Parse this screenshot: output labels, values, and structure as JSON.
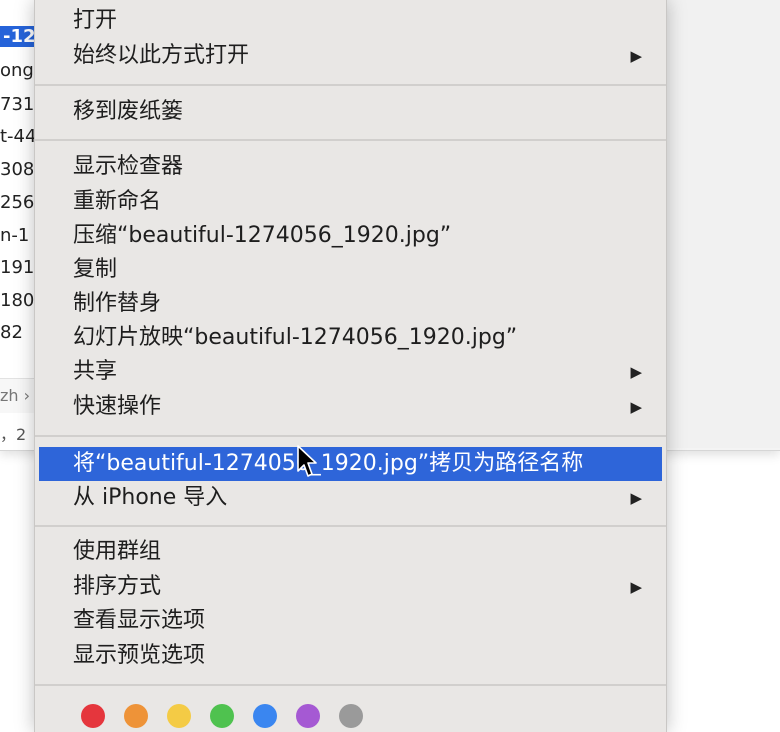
{
  "background": {
    "file_list": [
      "-12",
      "ong",
      "731",
      "t-44",
      "308",
      "256",
      "n-1",
      "191",
      "180",
      "82"
    ],
    "path_bar": "zh ›",
    "status_bar": "，2"
  },
  "menu": {
    "groups": [
      [
        {
          "label": "打开",
          "submenu": false
        },
        {
          "label": "始终以此方式打开",
          "submenu": true
        }
      ],
      [
        {
          "label": "移到废纸篓",
          "submenu": false
        }
      ],
      [
        {
          "label": "显示检查器",
          "submenu": false
        },
        {
          "label": "重新命名",
          "submenu": false
        },
        {
          "label": "压缩“beautiful-1274056_1920.jpg”",
          "submenu": false
        },
        {
          "label": "复制",
          "submenu": false
        },
        {
          "label": "制作替身",
          "submenu": false
        },
        {
          "label": "幻灯片放映“beautiful-1274056_1920.jpg”",
          "submenu": false
        },
        {
          "label": "共享",
          "submenu": true
        },
        {
          "label": "快速操作",
          "submenu": true
        }
      ],
      [
        {
          "label": "将“beautiful-1274056_1920.jpg”拷贝为路径名称",
          "submenu": false,
          "highlighted": true
        },
        {
          "label": "从 iPhone 导入",
          "submenu": true
        }
      ],
      [
        {
          "label": "使用群组",
          "submenu": false
        },
        {
          "label": "排序方式",
          "submenu": true
        },
        {
          "label": "查看显示选项",
          "submenu": false
        },
        {
          "label": "显示预览选项",
          "submenu": false
        }
      ]
    ],
    "submenu_arrow": "▶",
    "tag_colors": [
      {
        "name": "red",
        "color": "#e5363d"
      },
      {
        "name": "orange",
        "color": "#ee9338"
      },
      {
        "name": "yellow",
        "color": "#f4cb45"
      },
      {
        "name": "green",
        "color": "#4fc24f"
      },
      {
        "name": "blue",
        "color": "#3a86f0"
      },
      {
        "name": "purple",
        "color": "#a559d3"
      },
      {
        "name": "gray",
        "color": "#9a9a9a"
      }
    ]
  }
}
